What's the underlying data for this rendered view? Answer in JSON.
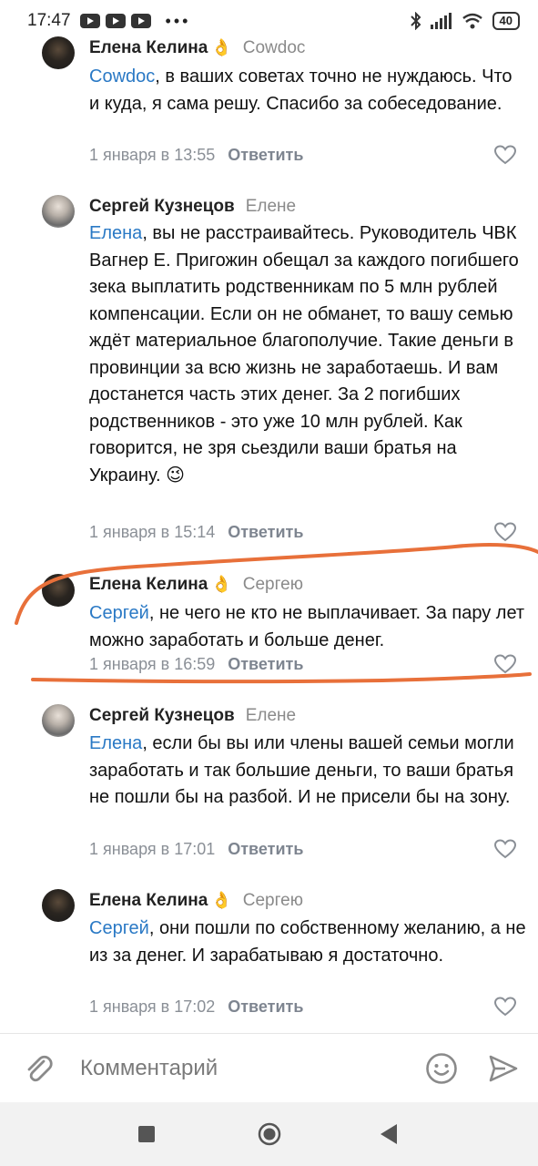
{
  "status_bar": {
    "time": "17:47",
    "dots": "•••",
    "battery": "40"
  },
  "comments": [
    {
      "author": "Елена Келина",
      "reply_to": "Cowdoc",
      "mention": "Cowdoc",
      "text": ", в ваших советах точно не нуждаюсь. Что и куда, я сама решу. Спасибо за собеседование.",
      "date": "1 января в 13:55",
      "reply_label": "Ответить"
    },
    {
      "author": "Сергей Кузнецов",
      "reply_to": "Елене",
      "mention": "Елена",
      "text": ", вы не расстраивайтесь. Руководитель ЧВК Вагнер Е. Пригожин обещал за каждого погибшего зека выплатить родственникам по 5 млн рублей компенсации. Если он не обманет, то вашу семью ждёт материальное благополучие. Такие деньги в провинции за всю жизнь не заработаешь. И вам достанется часть этих денег. За 2 погибших родственников - это уже 10 млн рублей. Как говорится, не зря сьездили ваши  братья на Украину. 😉",
      "date": "1 января в 15:14",
      "reply_label": "Ответить"
    },
    {
      "author": "Елена Келина",
      "reply_to": "Сергею",
      "mention": "Сергей",
      "text": ", не чего не кто не выплачивает. За пару лет можно заработать и больше денег.",
      "date": "1 января в 16:59",
      "reply_label": "Ответить"
    },
    {
      "author": "Сергей Кузнецов",
      "reply_to": "Елене",
      "mention": "Елена",
      "text": ", если бы вы или члены вашей семьи могли заработать и так большие деньги, то ваши братья не пошли бы на разбой. И не присели бы на зону.",
      "date": "1 января в 17:01",
      "reply_label": "Ответить"
    },
    {
      "author": "Елена Келина",
      "reply_to": "Сергею",
      "mention": "Сергей",
      "text": ", они пошли по собственному желанию, а не из за денег. И зарабатываю я достаточно.",
      "date": "1 января в 17:02",
      "reply_label": "Ответить"
    }
  ],
  "input": {
    "placeholder": "Комментарий"
  },
  "colors": {
    "mention": "#2a79c5",
    "meta": "#8a8f96",
    "annotation": "#e8703a"
  }
}
